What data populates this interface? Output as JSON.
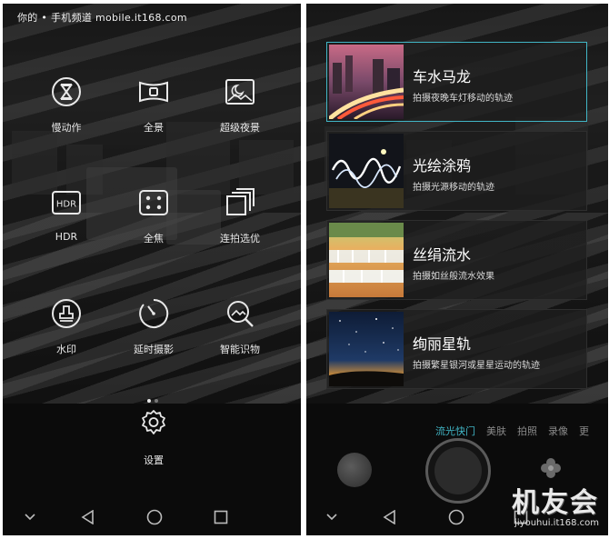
{
  "watermark_top": "你的 • 手机频道 mobile.it168.com",
  "left": {
    "modes": [
      {
        "label": "慢动作",
        "icon": "hourglass-icon"
      },
      {
        "label": "全景",
        "icon": "panorama-icon"
      },
      {
        "label": "超级夜景",
        "icon": "night-scene-icon"
      },
      {
        "label": "HDR",
        "icon": "hdr-icon"
      },
      {
        "label": "全焦",
        "icon": "all-focus-icon"
      },
      {
        "label": "连拍选优",
        "icon": "burst-icon"
      },
      {
        "label": "水印",
        "icon": "watermark-stamp-icon"
      },
      {
        "label": "延时摄影",
        "icon": "timelapse-icon"
      },
      {
        "label": "智能识物",
        "icon": "object-recognition-icon"
      }
    ],
    "hdr_icon_text": "HDR",
    "pager": {
      "current": 1,
      "total": 2
    },
    "settings_label": "设置"
  },
  "right": {
    "effects": [
      {
        "title": "车水马龙",
        "desc": "拍摄夜晚车灯移动的轨迹",
        "selected": true
      },
      {
        "title": "光绘涂鸦",
        "desc": "拍摄光源移动的轨迹",
        "selected": false
      },
      {
        "title": "丝绢流水",
        "desc": "拍摄如丝般流水效果",
        "selected": false
      },
      {
        "title": "绚丽星轨",
        "desc": "拍摄繁星银河或星星运动的轨迹",
        "selected": false
      }
    ],
    "camera_modes": [
      {
        "label": "流光快门",
        "active": true
      },
      {
        "label": "美肤",
        "active": false
      },
      {
        "label": "拍照",
        "active": false
      },
      {
        "label": "录像",
        "active": false
      },
      {
        "label": "更",
        "active": false
      }
    ]
  },
  "brand": {
    "name": "机友会",
    "url": "jiyouhui.it168.com"
  },
  "colors": {
    "accent": "#41b6c6",
    "active_mode": "#41b6c6",
    "inactive_mode": "#8a8a8a",
    "text": "#e8e8e8"
  }
}
